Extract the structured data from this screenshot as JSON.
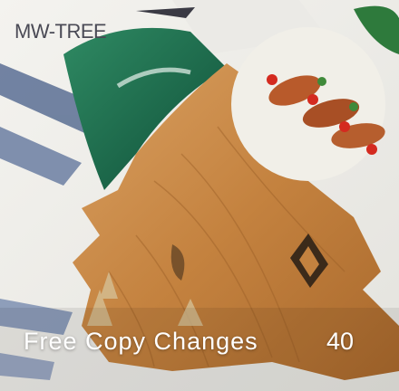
{
  "product": {
    "sku_label": "MW-TREE",
    "caption": "Free Copy Changes",
    "count": "40"
  },
  "colors": {
    "board_wood": "#c98a45",
    "resin_green": "#1f6b50",
    "caption_text": "#ffffff"
  },
  "icons": {
    "logo": "diamond-logo-icon"
  }
}
